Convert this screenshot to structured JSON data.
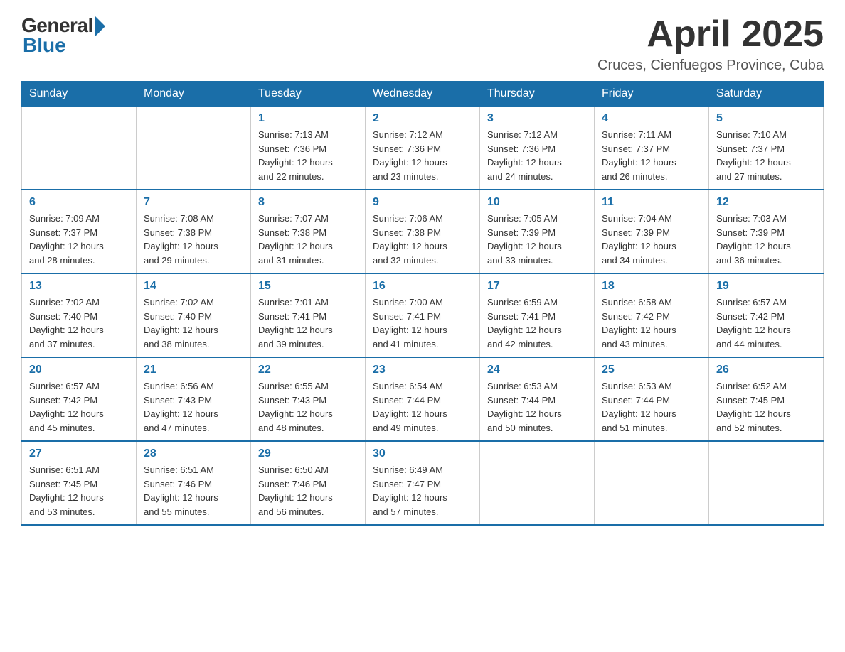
{
  "logo": {
    "general": "General",
    "blue": "Blue"
  },
  "title": "April 2025",
  "location": "Cruces, Cienfuegos Province, Cuba",
  "weekdays": [
    "Sunday",
    "Monday",
    "Tuesday",
    "Wednesday",
    "Thursday",
    "Friday",
    "Saturday"
  ],
  "weeks": [
    [
      {
        "day": "",
        "info": ""
      },
      {
        "day": "",
        "info": ""
      },
      {
        "day": "1",
        "info": "Sunrise: 7:13 AM\nSunset: 7:36 PM\nDaylight: 12 hours\nand 22 minutes."
      },
      {
        "day": "2",
        "info": "Sunrise: 7:12 AM\nSunset: 7:36 PM\nDaylight: 12 hours\nand 23 minutes."
      },
      {
        "day": "3",
        "info": "Sunrise: 7:12 AM\nSunset: 7:36 PM\nDaylight: 12 hours\nand 24 minutes."
      },
      {
        "day": "4",
        "info": "Sunrise: 7:11 AM\nSunset: 7:37 PM\nDaylight: 12 hours\nand 26 minutes."
      },
      {
        "day": "5",
        "info": "Sunrise: 7:10 AM\nSunset: 7:37 PM\nDaylight: 12 hours\nand 27 minutes."
      }
    ],
    [
      {
        "day": "6",
        "info": "Sunrise: 7:09 AM\nSunset: 7:37 PM\nDaylight: 12 hours\nand 28 minutes."
      },
      {
        "day": "7",
        "info": "Sunrise: 7:08 AM\nSunset: 7:38 PM\nDaylight: 12 hours\nand 29 minutes."
      },
      {
        "day": "8",
        "info": "Sunrise: 7:07 AM\nSunset: 7:38 PM\nDaylight: 12 hours\nand 31 minutes."
      },
      {
        "day": "9",
        "info": "Sunrise: 7:06 AM\nSunset: 7:38 PM\nDaylight: 12 hours\nand 32 minutes."
      },
      {
        "day": "10",
        "info": "Sunrise: 7:05 AM\nSunset: 7:39 PM\nDaylight: 12 hours\nand 33 minutes."
      },
      {
        "day": "11",
        "info": "Sunrise: 7:04 AM\nSunset: 7:39 PM\nDaylight: 12 hours\nand 34 minutes."
      },
      {
        "day": "12",
        "info": "Sunrise: 7:03 AM\nSunset: 7:39 PM\nDaylight: 12 hours\nand 36 minutes."
      }
    ],
    [
      {
        "day": "13",
        "info": "Sunrise: 7:02 AM\nSunset: 7:40 PM\nDaylight: 12 hours\nand 37 minutes."
      },
      {
        "day": "14",
        "info": "Sunrise: 7:02 AM\nSunset: 7:40 PM\nDaylight: 12 hours\nand 38 minutes."
      },
      {
        "day": "15",
        "info": "Sunrise: 7:01 AM\nSunset: 7:41 PM\nDaylight: 12 hours\nand 39 minutes."
      },
      {
        "day": "16",
        "info": "Sunrise: 7:00 AM\nSunset: 7:41 PM\nDaylight: 12 hours\nand 41 minutes."
      },
      {
        "day": "17",
        "info": "Sunrise: 6:59 AM\nSunset: 7:41 PM\nDaylight: 12 hours\nand 42 minutes."
      },
      {
        "day": "18",
        "info": "Sunrise: 6:58 AM\nSunset: 7:42 PM\nDaylight: 12 hours\nand 43 minutes."
      },
      {
        "day": "19",
        "info": "Sunrise: 6:57 AM\nSunset: 7:42 PM\nDaylight: 12 hours\nand 44 minutes."
      }
    ],
    [
      {
        "day": "20",
        "info": "Sunrise: 6:57 AM\nSunset: 7:42 PM\nDaylight: 12 hours\nand 45 minutes."
      },
      {
        "day": "21",
        "info": "Sunrise: 6:56 AM\nSunset: 7:43 PM\nDaylight: 12 hours\nand 47 minutes."
      },
      {
        "day": "22",
        "info": "Sunrise: 6:55 AM\nSunset: 7:43 PM\nDaylight: 12 hours\nand 48 minutes."
      },
      {
        "day": "23",
        "info": "Sunrise: 6:54 AM\nSunset: 7:44 PM\nDaylight: 12 hours\nand 49 minutes."
      },
      {
        "day": "24",
        "info": "Sunrise: 6:53 AM\nSunset: 7:44 PM\nDaylight: 12 hours\nand 50 minutes."
      },
      {
        "day": "25",
        "info": "Sunrise: 6:53 AM\nSunset: 7:44 PM\nDaylight: 12 hours\nand 51 minutes."
      },
      {
        "day": "26",
        "info": "Sunrise: 6:52 AM\nSunset: 7:45 PM\nDaylight: 12 hours\nand 52 minutes."
      }
    ],
    [
      {
        "day": "27",
        "info": "Sunrise: 6:51 AM\nSunset: 7:45 PM\nDaylight: 12 hours\nand 53 minutes."
      },
      {
        "day": "28",
        "info": "Sunrise: 6:51 AM\nSunset: 7:46 PM\nDaylight: 12 hours\nand 55 minutes."
      },
      {
        "day": "29",
        "info": "Sunrise: 6:50 AM\nSunset: 7:46 PM\nDaylight: 12 hours\nand 56 minutes."
      },
      {
        "day": "30",
        "info": "Sunrise: 6:49 AM\nSunset: 7:47 PM\nDaylight: 12 hours\nand 57 minutes."
      },
      {
        "day": "",
        "info": ""
      },
      {
        "day": "",
        "info": ""
      },
      {
        "day": "",
        "info": ""
      }
    ]
  ]
}
